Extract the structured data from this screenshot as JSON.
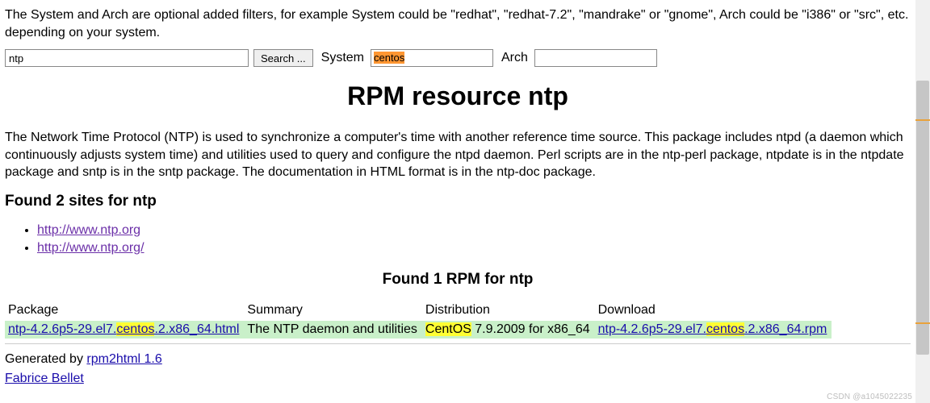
{
  "intro": "The System and Arch are optional added filters, for example System could be \"redhat\", \"redhat-7.2\", \"mandrake\" or \"gnome\", Arch could be \"i386\" or \"src\", etc. depending on your system.",
  "search": {
    "query_value": "ntp",
    "button_label": "Search ...",
    "system_label": "System",
    "system_value": "centos",
    "arch_label": "Arch",
    "arch_value": ""
  },
  "title": "RPM resource ntp",
  "description": "The Network Time Protocol (NTP) is used to synchronize a computer's time with another reference time source. This package includes ntpd (a daemon which continuously adjusts system time) and utilities used to query and configure the ntpd daemon. Perl scripts are in the ntp-perl package, ntpdate is in the ntpdate package and sntp is in the sntp package. The documentation in HTML format is in the ntp-doc package.",
  "found_sites_heading": "Found 2 sites for ntp",
  "sites": [
    "http://www.ntp.org",
    "http://www.ntp.org/"
  ],
  "found_rpm_heading": "Found 1 RPM for ntp",
  "table": {
    "headers": {
      "package": "Package",
      "summary": "Summary",
      "distribution": "Distribution",
      "download": "Download"
    },
    "row": {
      "package_pre": "ntp-4.2.6p5-29.el7.",
      "package_kw": "centos",
      "package_post": ".2.x86_64.html",
      "summary": "The NTP daemon and utilities",
      "dist_pre": "CentOS",
      "dist_post": " 7.9.2009 for x86_64",
      "download_pre": "ntp-4.2.6p5-29.el7.",
      "download_kw": "centos",
      "download_post": ".2.x86_64.rpm"
    }
  },
  "generated_prefix": "Generated by ",
  "generated_link": "rpm2html 1.6",
  "author": "Fabrice Bellet",
  "watermark": "CSDN @a1045022235"
}
